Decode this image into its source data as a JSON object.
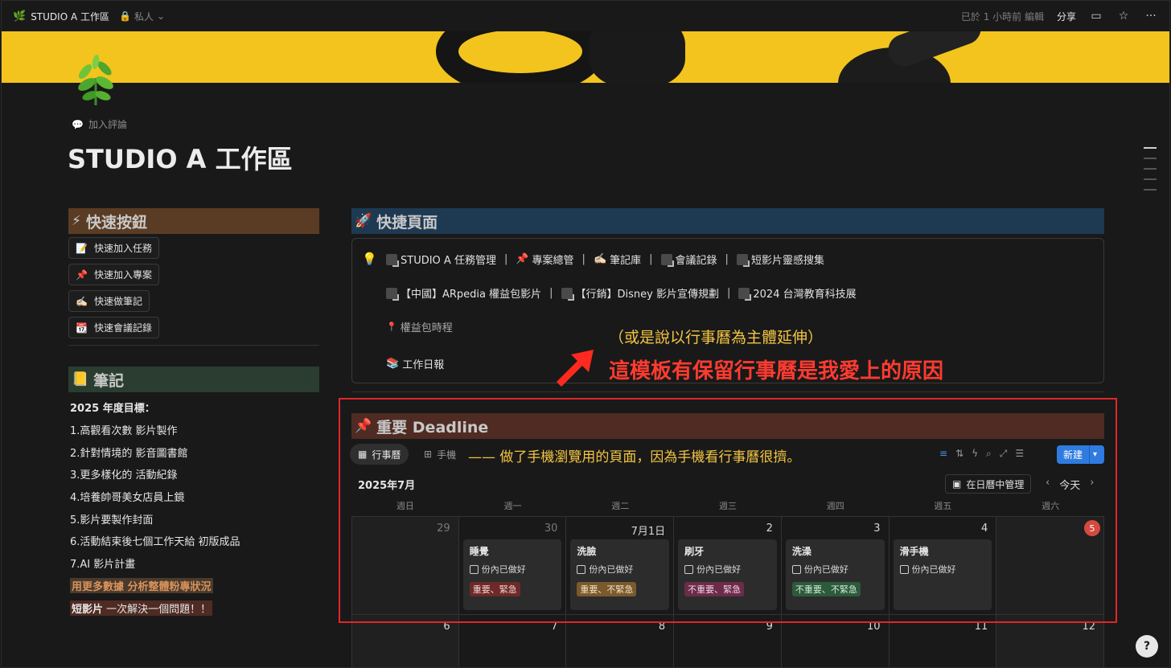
{
  "topbar": {
    "workspace": "STUDIO A 工作區",
    "privacy": "私人",
    "edited": "已於 1 小時前 編輯",
    "share": "分享"
  },
  "page": {
    "comment_prompt": "加入評論",
    "title": "STUDIO A 工作區"
  },
  "quick_buttons": {
    "heading": "快速按鈕",
    "items": [
      {
        "icon": "📝",
        "label": "快速加入任務"
      },
      {
        "icon": "📌",
        "label": "快速加入專案"
      },
      {
        "icon": "✍🏻",
        "label": "快速做筆記"
      },
      {
        "icon": "📆",
        "label": "快速會議記錄"
      }
    ]
  },
  "notes": {
    "heading": "筆記",
    "goal_title": "2025 年度目標：",
    "goals": [
      "1.高觀看次數 影片製作",
      "2.針對情境的 影音圖書館",
      "3.更多樣化的 活動紀錄",
      "4.培養帥哥美女店員上鏡",
      "5.影片要製作封面",
      "6.活動結束後七個工作天給 初版成品",
      "7.AI 影片計畫"
    ],
    "highlight_line": "用更多數據 分析整體粉專狀況",
    "short_video_bold": "短影片",
    "short_video_rest": " 一次解決一個問題！！"
  },
  "quick_pages": {
    "heading": "快捷頁面",
    "row1": [
      "STUDIO A 任務管理",
      "專案總管",
      "筆記庫",
      "會議記錄",
      "短影片靈感搜集"
    ],
    "row2": [
      "【中國】ARpedia 權益包影片",
      "【行銷】Disney 影片宣傳規劃",
      "2024 台灣教育科技展"
    ],
    "row3": "權益包時程",
    "row4": "工作日報"
  },
  "annotations": {
    "top_small": "（或是說以行事曆為主體延伸）",
    "top_big": "這模板有保留行事曆是我愛上的原因",
    "tabs_note": "——  做了手機瀏覽用的頁面，因為手機看行事曆很擠。"
  },
  "deadline": {
    "heading": "重要 Deadline",
    "tabs": [
      "行事曆",
      "手機"
    ],
    "new_button": "新建",
    "month": "2025年7月",
    "manage": "在日曆中管理",
    "today": "今天",
    "weekdays": [
      "週日",
      "週一",
      "週二",
      "週三",
      "週四",
      "週五",
      "週六"
    ],
    "week1_days": [
      "29",
      "30",
      "7月1日",
      "2",
      "3",
      "4",
      "5"
    ],
    "week2_days": [
      "6",
      "7",
      "8",
      "9",
      "10",
      "11",
      "12"
    ],
    "checkbox_label": "份內已做好",
    "cards": [
      {
        "title": "睡覺",
        "tag": "重要、緊急"
      },
      {
        "title": "洗臉",
        "tag": "重要、不緊急"
      },
      {
        "title": "刷牙",
        "tag": "不重要、緊急"
      },
      {
        "title": "洗澡",
        "tag": "不重要、不緊急"
      },
      {
        "title": "滑手機",
        "tag": ""
      }
    ]
  },
  "colors": {
    "accent": "#2f7be0",
    "annotation_yellow": "#f4c542",
    "annotation_red": "#ff3b30",
    "frame_red": "#e0262a"
  }
}
